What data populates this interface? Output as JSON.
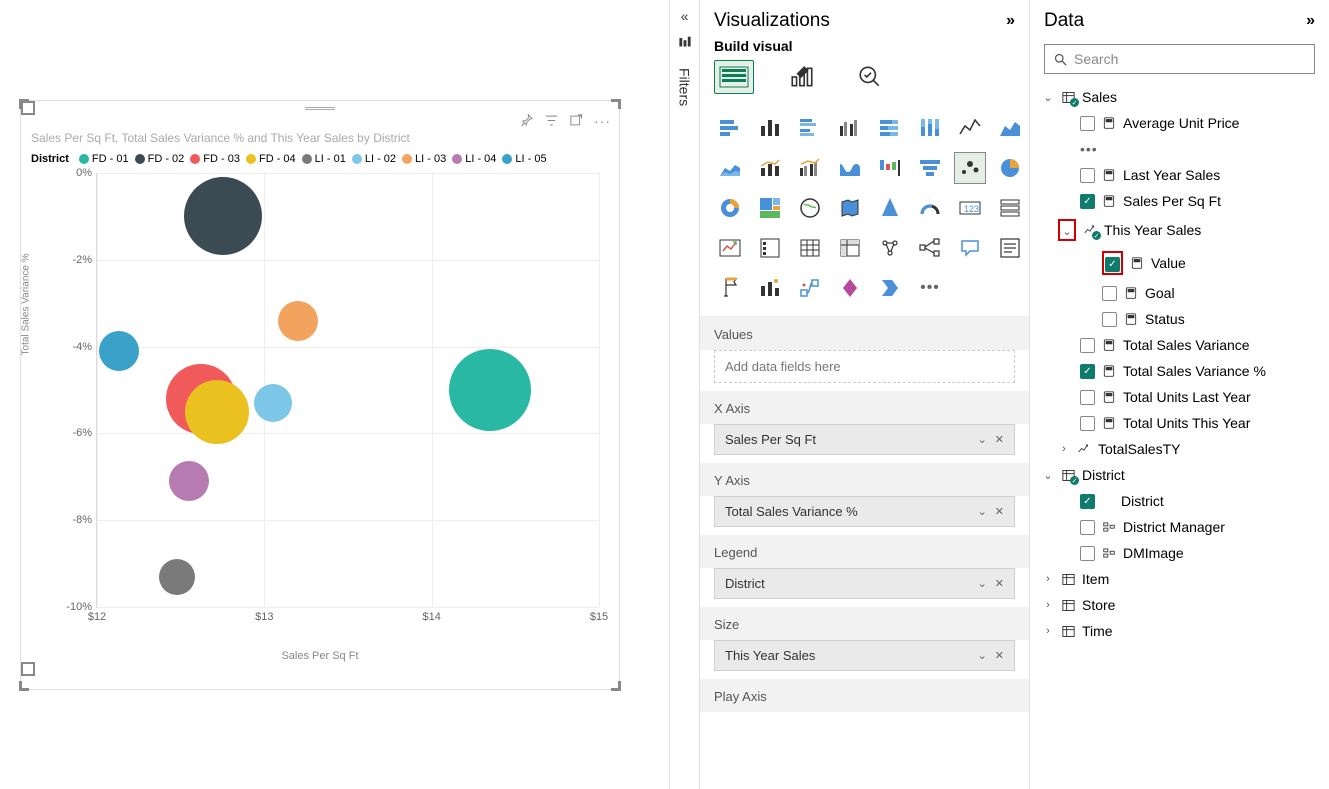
{
  "chart": {
    "title": "Sales Per Sq Ft, Total Sales Variance % and This Year Sales by District",
    "legend_label": "District",
    "xlabel": "Sales Per Sq Ft",
    "ylabel": "Total Sales Variance %"
  },
  "chart_data": {
    "type": "scatter",
    "xlabel": "Sales Per Sq Ft",
    "ylabel": "Total Sales Variance %",
    "xlim": [
      12,
      15
    ],
    "ylim": [
      -10,
      0
    ],
    "xticks": [
      "$12",
      "$13",
      "$14",
      "$15"
    ],
    "yticks": [
      "0%",
      "-2%",
      "-4%",
      "-6%",
      "-8%",
      "-10%"
    ],
    "series": [
      {
        "name": "FD - 01",
        "color": "#28b8a3",
        "x": 14.35,
        "y": -5.0,
        "size": 82
      },
      {
        "name": "FD - 02",
        "color": "#3c4a53",
        "x": 12.75,
        "y": -1.0,
        "size": 78
      },
      {
        "name": "FD - 03",
        "color": "#f05a5a",
        "x": 12.62,
        "y": -5.2,
        "size": 70
      },
      {
        "name": "FD - 04",
        "color": "#eac11f",
        "x": 12.72,
        "y": -5.5,
        "size": 64
      },
      {
        "name": "LI - 01",
        "color": "#7a7a7a",
        "x": 12.48,
        "y": -9.3,
        "size": 36
      },
      {
        "name": "LI - 02",
        "color": "#7cc6e8",
        "x": 13.05,
        "y": -5.3,
        "size": 38
      },
      {
        "name": "LI - 03",
        "color": "#f2a35e",
        "x": 13.2,
        "y": -3.4,
        "size": 40
      },
      {
        "name": "LI - 04",
        "color": "#b67bb0",
        "x": 12.55,
        "y": -7.1,
        "size": 40
      },
      {
        "name": "LI - 05",
        "color": "#3aa1c9",
        "x": 12.13,
        "y": -4.1,
        "size": 40
      }
    ]
  },
  "filters": {
    "label": "Filters"
  },
  "viz": {
    "title": "Visualizations",
    "build": "Build visual",
    "wells": {
      "values": {
        "label": "Values",
        "placeholder": "Add data fields here"
      },
      "xaxis": {
        "label": "X Axis",
        "chip": "Sales Per Sq Ft"
      },
      "yaxis": {
        "label": "Y Axis",
        "chip": "Total Sales Variance %"
      },
      "legend": {
        "label": "Legend",
        "chip": "District"
      },
      "size": {
        "label": "Size",
        "chip": "This Year Sales"
      },
      "play": {
        "label": "Play Axis"
      }
    }
  },
  "data": {
    "title": "Data",
    "search_placeholder": "Search",
    "tables": {
      "sales": {
        "name": "Sales",
        "fields": {
          "avg_unit_price": "Average Unit Price",
          "last_year_sales": "Last Year Sales",
          "sales_per_sqft": "Sales Per Sq Ft",
          "this_year_sales": "This Year Sales",
          "value": "Value",
          "goal": "Goal",
          "status": "Status",
          "total_sales_variance": "Total Sales Variance",
          "total_sales_variance_pct": "Total Sales Variance %",
          "total_units_last_year": "Total Units Last Year",
          "total_units_this_year": "Total Units This Year",
          "total_sales_ty": "TotalSalesTY"
        }
      },
      "district": {
        "name": "District",
        "fields": {
          "district": "District",
          "district_manager": "District Manager",
          "dm_image": "DMImage"
        }
      },
      "item": "Item",
      "store": "Store",
      "time": "Time"
    }
  }
}
